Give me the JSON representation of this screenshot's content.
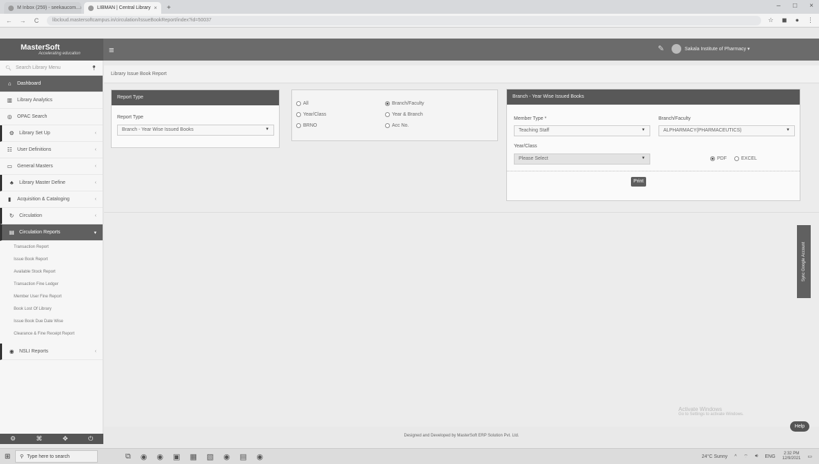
{
  "browser": {
    "tabs": [
      {
        "label": "M Inbox (259) - seekaucom...",
        "active": false
      },
      {
        "label": "LIBMAN | Central Library",
        "active": true
      }
    ],
    "new_tab": "+",
    "window_controls": [
      "–",
      "□",
      "×"
    ],
    "url": "libcloud.mastersoftcampus.in/circulation/IssueBookReport/index?id=50037",
    "nav": [
      "←",
      "→",
      "C"
    ]
  },
  "header": {
    "brand": "MasterSoft",
    "tagline": "Accelerating education",
    "menu_icon": "hamburger-icon",
    "user_name": "Sakala Institute of Pharmacy ▾"
  },
  "sidebar": {
    "search_placeholder": "Search Library Menu",
    "items": [
      {
        "label": "Dashboard",
        "icon": "home-icon",
        "dark": true
      },
      {
        "label": "Library Analytics",
        "icon": "chart-icon"
      },
      {
        "label": "OPAC Search",
        "icon": "search-icon"
      },
      {
        "label": "Library Set Up",
        "icon": "gear-icon",
        "marked": true
      },
      {
        "label": "User Definitions",
        "icon": "users-icon"
      },
      {
        "label": "General Masters",
        "icon": "folder-icon"
      },
      {
        "label": "Library Master Define",
        "icon": "org-icon",
        "marked": true
      },
      {
        "label": "Acquisition & Cataloging",
        "icon": "book-icon"
      },
      {
        "label": "Circulation",
        "icon": "refresh-icon",
        "marked": true
      },
      {
        "label": "Circulation Reports",
        "icon": "report-icon",
        "dark": true
      }
    ],
    "sub_items": [
      "Transaction Report",
      "Issue Book Report",
      "Available Stock Report",
      "Transaction Fine Ledger",
      "Member User Fine Report",
      "Book Lost Of Library",
      "Issue Book Due Date Wise",
      "Clearance & Fine Receipt Report"
    ],
    "last_item": {
      "label": "NSLI Reports",
      "icon": "report-icon"
    },
    "footer_icons": [
      "gear-icon",
      "grid-icon",
      "settings-icon",
      "power-icon"
    ]
  },
  "breadcrumb": "Library Issue Book Report",
  "report_panel": {
    "title": "Report Type",
    "field_label": "Report Type",
    "selected": "Branch - Year Wise Issued Books"
  },
  "radios": [
    {
      "label": "All",
      "checked": false
    },
    {
      "label": "Branch/Faculty",
      "checked": true
    },
    {
      "label": "Year/Class",
      "checked": false
    },
    {
      "label": "Year & Branch",
      "checked": false
    },
    {
      "label": "BRNO",
      "checked": false
    },
    {
      "label": "Acc No.",
      "checked": false
    }
  ],
  "filter_panel": {
    "title": "Branch - Year Wise Issued Books",
    "member_type_label": "Member Type *",
    "member_type_value": "Teaching Staff",
    "branch_label": "Branch/Faculty",
    "branch_value": "ALPHARMACY(PHARMACEUTICS)",
    "year_label": "Year/Class",
    "year_value": "Please Select",
    "format_options": [
      {
        "label": "PDF",
        "checked": true
      },
      {
        "label": "EXCEL",
        "checked": false
      }
    ],
    "print_label": "Print"
  },
  "footer_text": "Designed and Developed by MasterSoft ERP Solution Pvt. Ltd.",
  "side_tab": "Sync Google Account",
  "help_label": "Help",
  "watermark": {
    "line1": "Activate Windows",
    "line2": "Go to Settings to activate Windows."
  },
  "taskbar": {
    "search_placeholder": "Type here to search",
    "weather": "24°C Sunny",
    "lang": "ENG",
    "time": "2:32 PM",
    "date": "12/9/2021"
  }
}
